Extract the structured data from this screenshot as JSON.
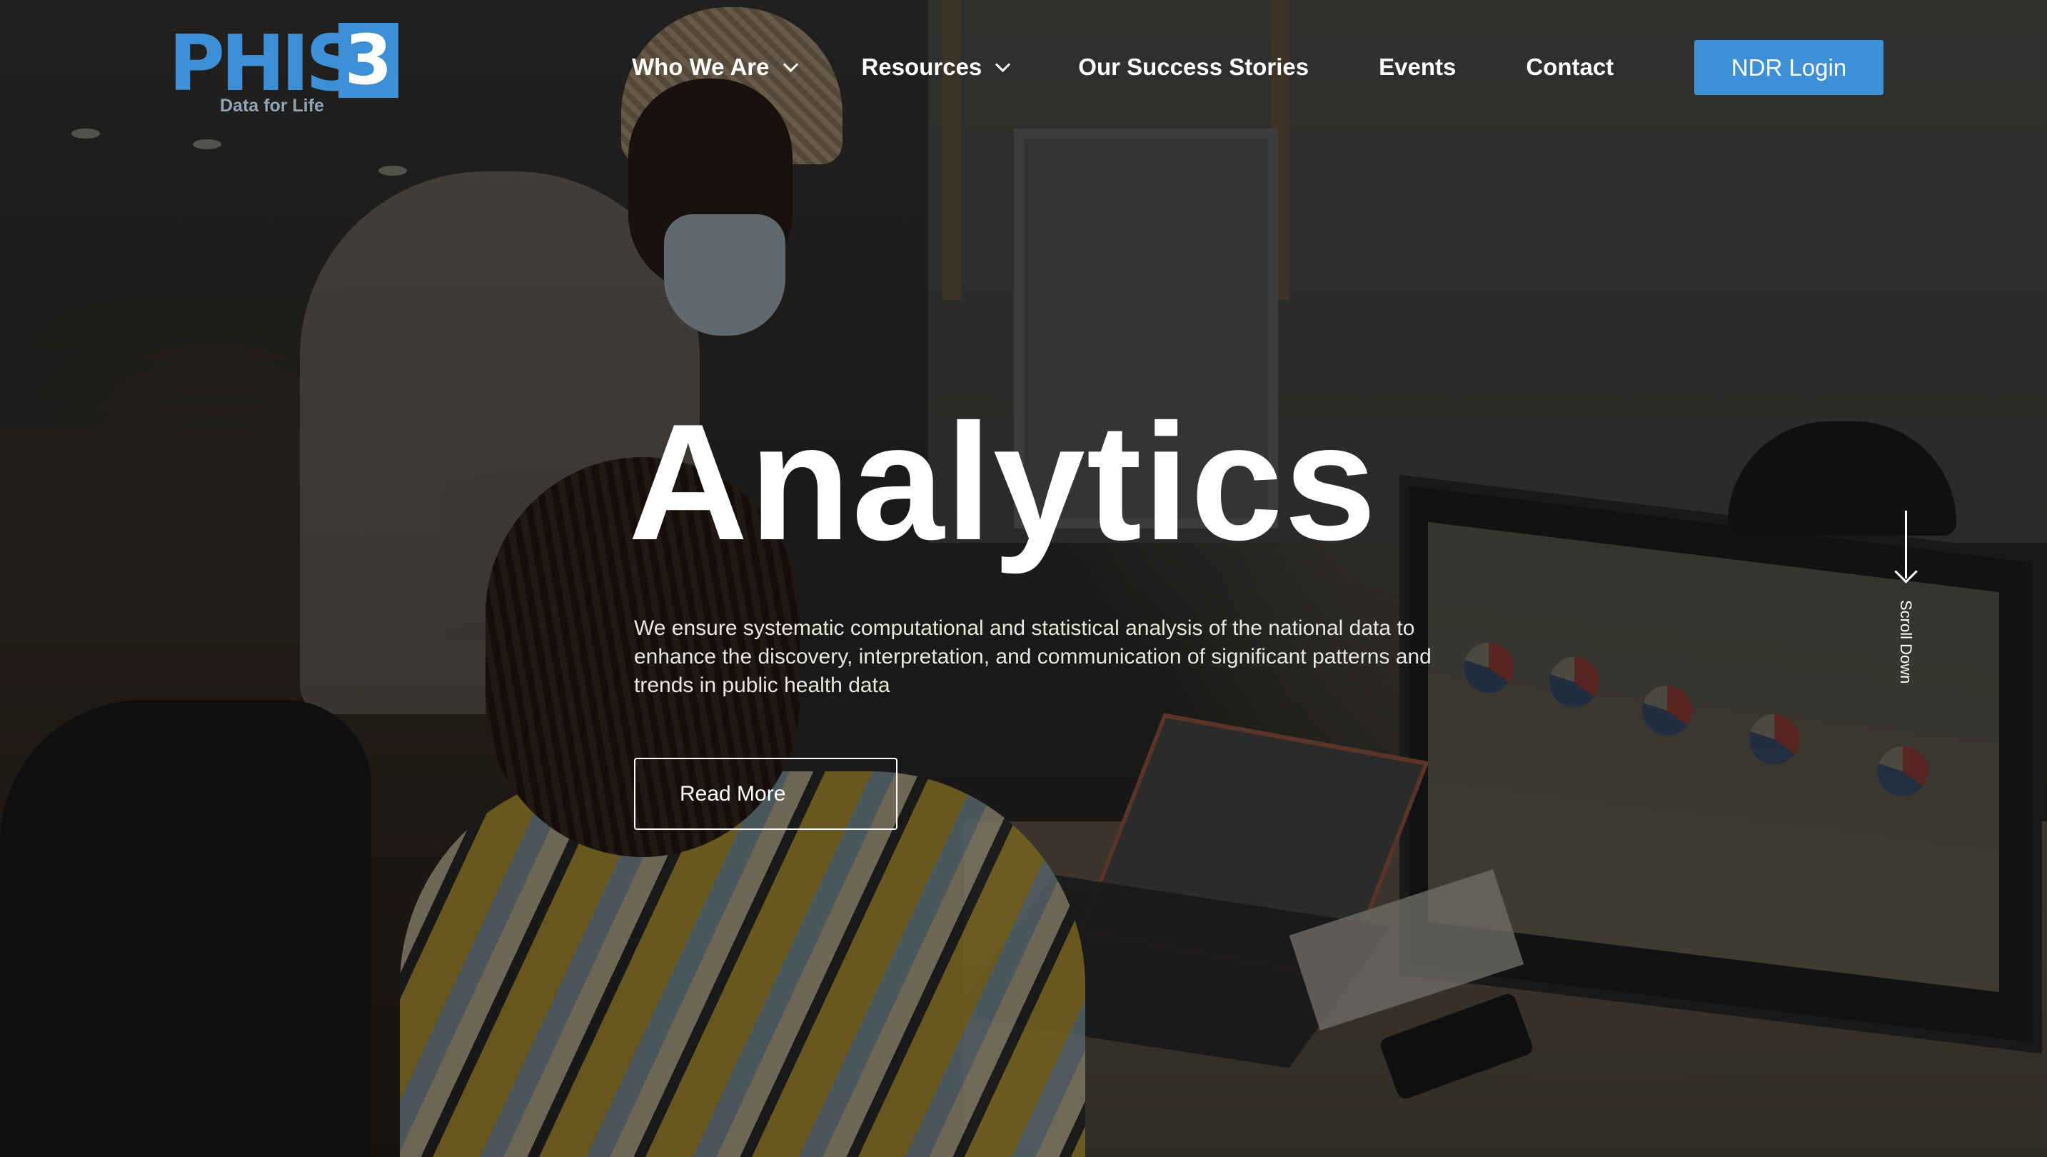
{
  "brand": {
    "logo_text": "PHIS",
    "logo_box_text": "3",
    "tagline": "Data for Life",
    "accent_color": "#3d8fd6"
  },
  "nav": {
    "items": [
      {
        "label": "Who We Are",
        "has_dropdown": true
      },
      {
        "label": "Resources",
        "has_dropdown": true
      },
      {
        "label": "Our Success Stories",
        "has_dropdown": false
      },
      {
        "label": "Events",
        "has_dropdown": false
      },
      {
        "label": "Contact",
        "has_dropdown": false
      }
    ],
    "login_label": "NDR Login"
  },
  "hero": {
    "title": "Analytics",
    "description": "We ensure systematic computational and statistical analysis of the national data to enhance the discovery, interpretation, and communication of significant patterns and trends in public health data",
    "cta_label": "Read More",
    "scroll_label": "Scroll Down"
  },
  "icons": [
    "chevron-down-icon",
    "arrow-down-icon"
  ]
}
